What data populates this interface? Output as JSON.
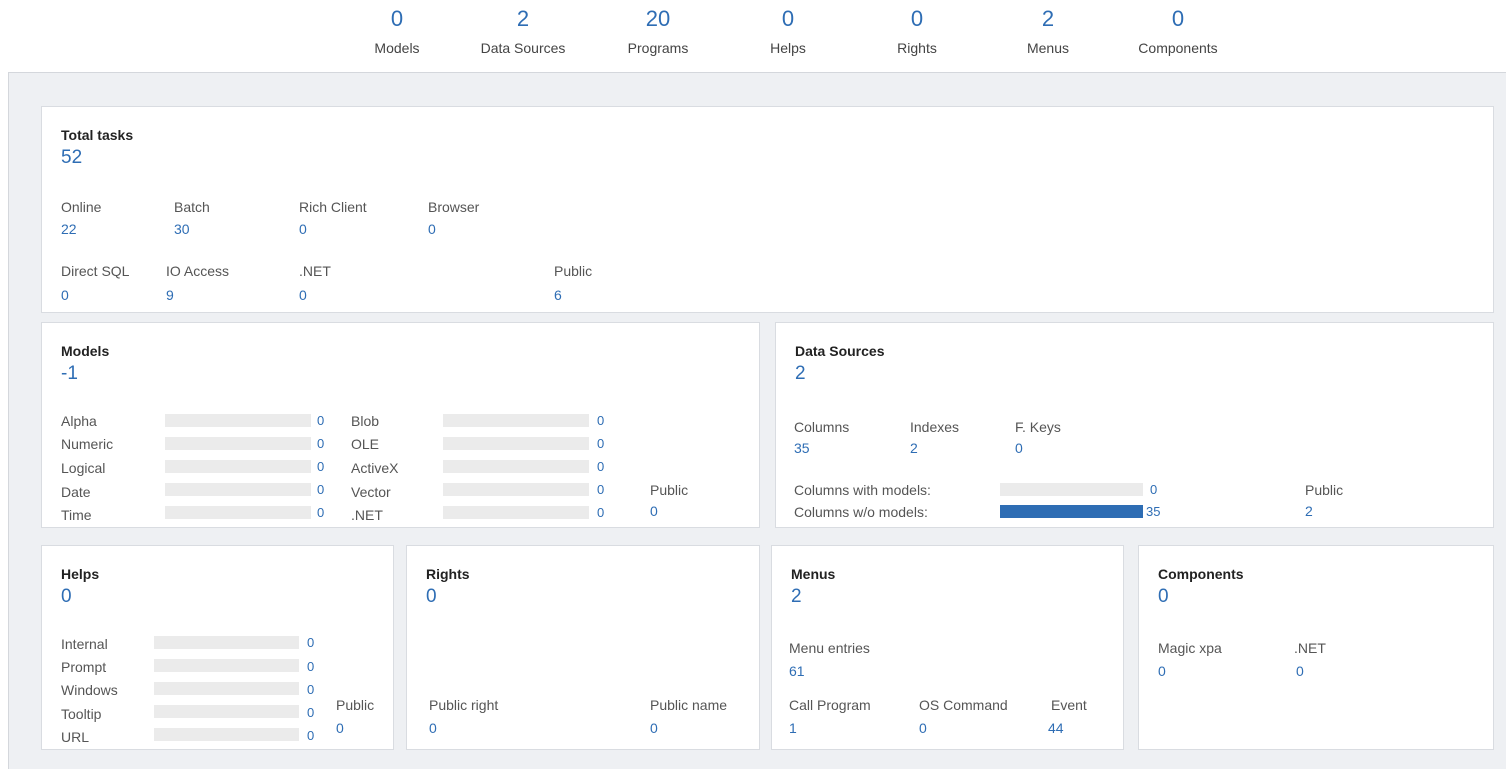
{
  "summary": [
    {
      "label": "Models",
      "value": "0"
    },
    {
      "label": "Data Sources",
      "value": "2"
    },
    {
      "label": "Programs",
      "value": "20"
    },
    {
      "label": "Helps",
      "value": "0"
    },
    {
      "label": "Rights",
      "value": "0"
    },
    {
      "label": "Menus",
      "value": "2"
    },
    {
      "label": "Components",
      "value": "0"
    }
  ],
  "total_tasks": {
    "title": "Total tasks",
    "value": "52",
    "online": {
      "label": "Online",
      "value": "22"
    },
    "batch": {
      "label": "Batch",
      "value": "30"
    },
    "rich_client": {
      "label": "Rich Client",
      "value": "0"
    },
    "browser": {
      "label": "Browser",
      "value": "0"
    },
    "direct_sql": {
      "label": "Direct SQL",
      "value": "0"
    },
    "io_access": {
      "label": "IO Access",
      "value": "9"
    },
    "dotnet": {
      "label": ".NET",
      "value": "0"
    },
    "public": {
      "label": "Public",
      "value": "6"
    }
  },
  "models": {
    "title": "Models",
    "value": "-1",
    "left": [
      {
        "label": "Alpha",
        "value": "0",
        "fraction": 0
      },
      {
        "label": "Numeric",
        "value": "0",
        "fraction": 0
      },
      {
        "label": "Logical",
        "value": "0",
        "fraction": 0
      },
      {
        "label": "Date",
        "value": "0",
        "fraction": 0
      },
      {
        "label": "Time",
        "value": "0",
        "fraction": 0
      }
    ],
    "right": [
      {
        "label": "Blob",
        "value": "0",
        "fraction": 0
      },
      {
        "label": "OLE",
        "value": "0",
        "fraction": 0
      },
      {
        "label": "ActiveX",
        "value": "0",
        "fraction": 0
      },
      {
        "label": "Vector",
        "value": "0",
        "fraction": 0
      },
      {
        "label": ".NET",
        "value": "0",
        "fraction": 0
      }
    ],
    "public": {
      "label": "Public",
      "value": "0"
    }
  },
  "data_sources": {
    "title": "Data Sources",
    "value": "2",
    "columns": {
      "label": "Columns",
      "value": "35"
    },
    "indexes": {
      "label": "Indexes",
      "value": "2"
    },
    "fkeys": {
      "label": "F. Keys",
      "value": "0"
    },
    "with_models": {
      "label": "Columns with models:",
      "value": "0",
      "fraction": 0
    },
    "without_models": {
      "label": "Columns w/o models:",
      "value": "35",
      "fraction": 1
    },
    "public": {
      "label": "Public",
      "value": "2"
    }
  },
  "helps": {
    "title": "Helps",
    "value": "0",
    "items": [
      {
        "label": "Internal",
        "value": "0",
        "fraction": 0
      },
      {
        "label": "Prompt",
        "value": "0",
        "fraction": 0
      },
      {
        "label": "Windows",
        "value": "0",
        "fraction": 0
      },
      {
        "label": "Tooltip",
        "value": "0",
        "fraction": 0
      },
      {
        "label": "URL",
        "value": "0",
        "fraction": 0
      }
    ],
    "public": {
      "label": "Public",
      "value": "0"
    }
  },
  "rights": {
    "title": "Rights",
    "value": "0",
    "public_right": {
      "label": "Public right",
      "value": "0"
    },
    "public_name": {
      "label": "Public name",
      "value": "0"
    }
  },
  "menus": {
    "title": "Menus",
    "value": "2",
    "menu_entries": {
      "label": "Menu entries",
      "value": "61"
    },
    "call_program": {
      "label": "Call Program",
      "value": "1"
    },
    "os_command": {
      "label": "OS Command",
      "value": "0"
    },
    "event": {
      "label": "Event",
      "value": "44"
    }
  },
  "components": {
    "title": "Components",
    "value": "0",
    "magic_xpa": {
      "label": "Magic xpa",
      "value": "0"
    },
    "dotnet": {
      "label": ".NET",
      "value": "0"
    }
  },
  "colors": {
    "accent": "#2e6db4",
    "bar_track": "#ebebeb",
    "panel_bg": "#eef0f3"
  }
}
